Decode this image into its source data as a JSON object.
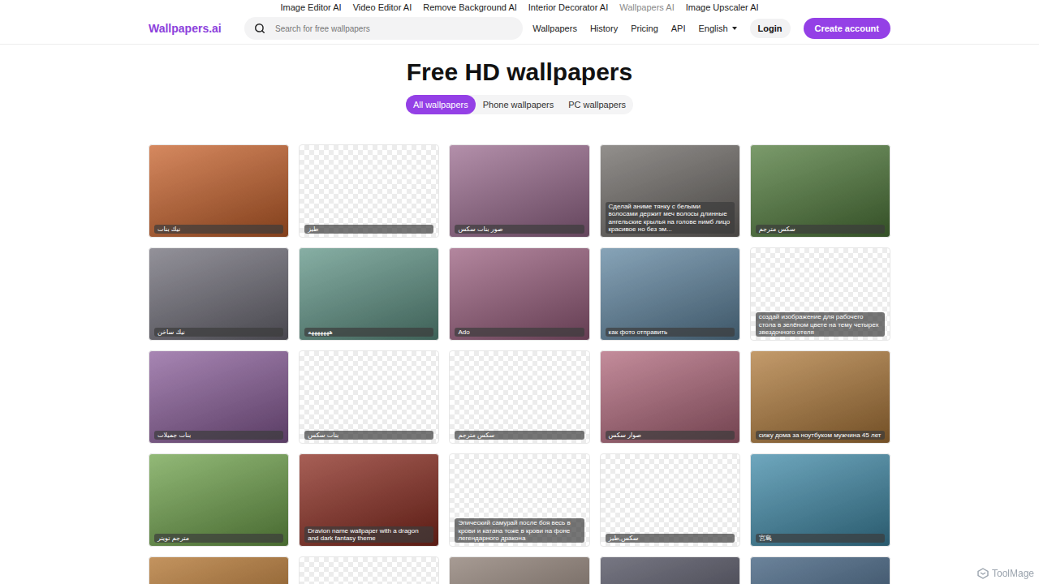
{
  "product_bar": [
    {
      "label": "Image Editor AI",
      "selected": false
    },
    {
      "label": "Video Editor AI",
      "selected": false
    },
    {
      "label": "Remove Background AI",
      "selected": false
    },
    {
      "label": "Interior Decorator AI",
      "selected": false
    },
    {
      "label": "Wallpapers AI",
      "selected": true
    },
    {
      "label": "Image Upscaler AI",
      "selected": false
    }
  ],
  "logo": "Wallpapers.ai",
  "search": {
    "placeholder": "Search for free wallpapers"
  },
  "nav": [
    "Wallpapers",
    "History",
    "Pricing",
    "API"
  ],
  "language": "English",
  "login": "Login",
  "create_account": "Create account",
  "title": "Free HD wallpapers",
  "tabs": [
    {
      "label": "All wallpapers",
      "selected": true
    },
    {
      "label": "Phone wallpapers",
      "selected": false
    },
    {
      "label": "PC wallpapers",
      "selected": false
    }
  ],
  "wallpapers": [
    {
      "caption": "نيك بنات",
      "kind": "picture",
      "color": "#c8612a"
    },
    {
      "caption": "طيز",
      "kind": "empty"
    },
    {
      "caption": "صور بنات سكس",
      "kind": "picture",
      "color": "#9a6a8e"
    },
    {
      "caption": "Сделай аниме тянку с белыми волосами держит меч волосы длинные ангельские крылья на голове нимб лицо красивое но без эм...",
      "kind": "picture",
      "color": "#6e6a66"
    },
    {
      "caption": "سكس مترجم",
      "kind": "picture",
      "color": "#4f7a3a"
    },
    {
      "caption": "نيك ساخن",
      "kind": "picture",
      "color": "#6f6d78"
    },
    {
      "caption": "هههههههه",
      "kind": "picture",
      "color": "#5f9486"
    },
    {
      "caption": "Ado",
      "kind": "picture",
      "color": "#9a5e7e"
    },
    {
      "caption": "как фото отправить",
      "kind": "picture",
      "color": "#5f85a0"
    },
    {
      "caption": "создай изображение для рабочего стола в зелёном цвете на тему четырех звездочного отеля",
      "kind": "empty"
    },
    {
      "caption": "بنات جميلات",
      "kind": "picture",
      "color": "#8a5d9a"
    },
    {
      "caption": "بنات سكس",
      "kind": "empty"
    },
    {
      "caption": "سكس مترجم",
      "kind": "empty"
    },
    {
      "caption": "صوار سكس",
      "kind": "picture",
      "color": "#b0667a"
    },
    {
      "caption": "сижу дома за ноутбуком мужчина 45 лет",
      "kind": "picture",
      "color": "#b07a3a"
    },
    {
      "caption": "مترجم تويتر",
      "kind": "picture",
      "color": "#6ea24a"
    },
    {
      "caption": "Dravion name wallpaper with a dragon and dark fantasy theme",
      "kind": "picture",
      "color": "#8a2a1e"
    },
    {
      "caption": "Эпический самурай после боя весь в крови и катана тоже в крови на фоне легендарного дракона",
      "kind": "empty"
    },
    {
      "caption": "سكس,طيز",
      "kind": "empty"
    },
    {
      "caption": "宮島",
      "kind": "picture",
      "color": "#3f8aa8"
    },
    {
      "kind": "picture",
      "color": "#b0702a"
    },
    {
      "kind": "empty"
    },
    {
      "kind": "picture",
      "color": "#8a7a70"
    },
    {
      "kind": "picture",
      "color": "#4a4a5a"
    },
    {
      "kind": "picture",
      "color": "#3a5a7a"
    }
  ],
  "watermark": "ToolMage"
}
